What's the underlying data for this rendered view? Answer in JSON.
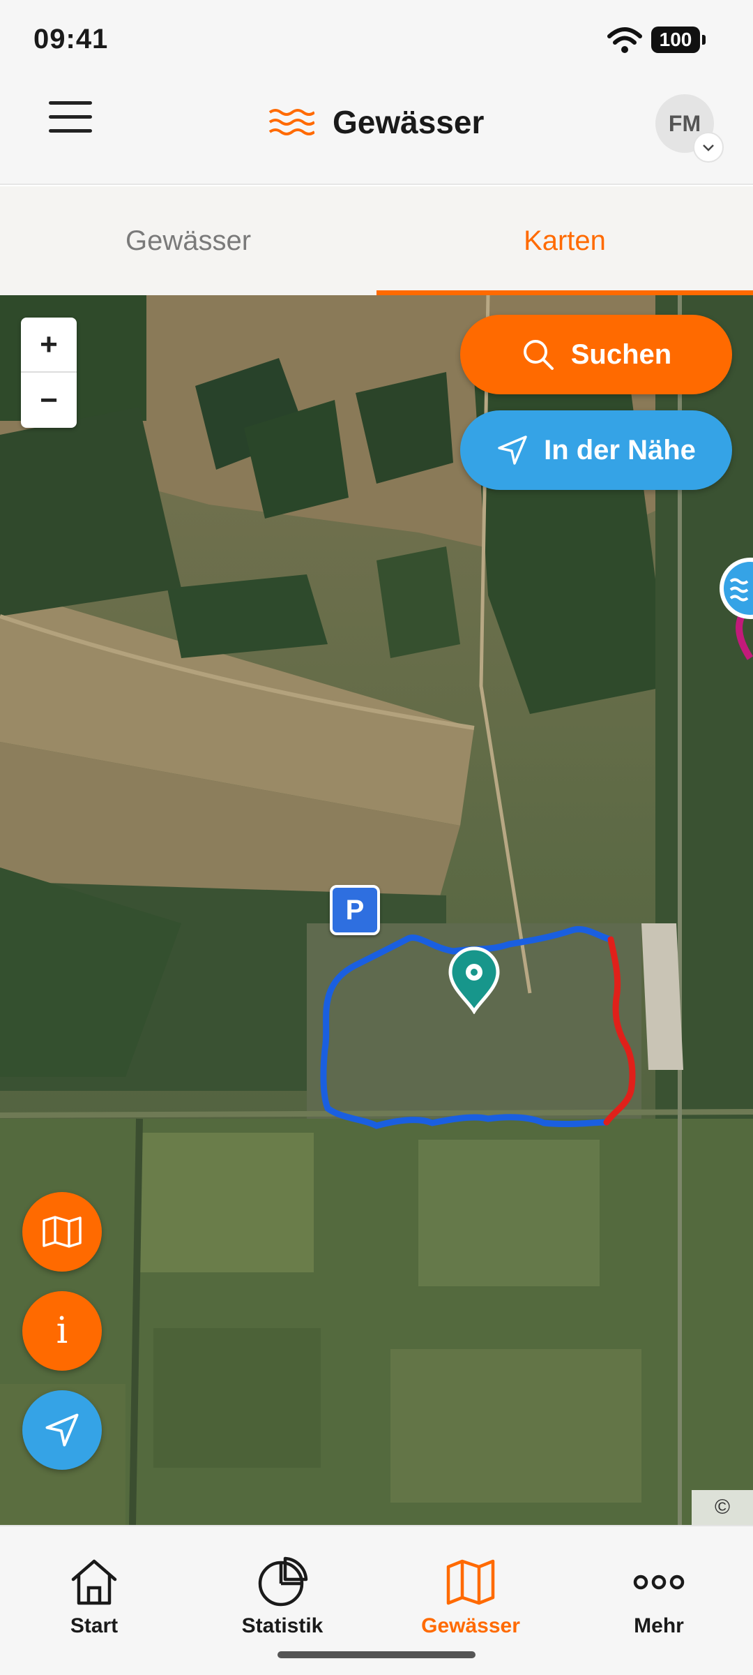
{
  "status_bar": {
    "time": "09:41",
    "battery": "100"
  },
  "header": {
    "title": "Gewässer",
    "avatar_initials": "FM"
  },
  "tabs": [
    {
      "label": "Gewässer",
      "active": false
    },
    {
      "label": "Karten",
      "active": true
    }
  ],
  "map": {
    "search_label": "Suchen",
    "nearby_label": "In der Nähe",
    "zoom_in": "+",
    "zoom_out": "−",
    "parking_label": "P",
    "copyright": "©",
    "info_label": "i"
  },
  "bottom_nav": [
    {
      "label": "Start",
      "icon": "home-icon",
      "active": false
    },
    {
      "label": "Statistik",
      "icon": "pie-chart-icon",
      "active": false
    },
    {
      "label": "Gewässer",
      "icon": "map-icon",
      "active": true
    },
    {
      "label": "Mehr",
      "icon": "more-icon",
      "active": false
    }
  ],
  "colors": {
    "accent": "#ff6a00",
    "blue": "#35a3e6",
    "boundary_blue": "#1a5fe0",
    "boundary_red": "#e0201a",
    "marker_teal": "#17968b"
  }
}
